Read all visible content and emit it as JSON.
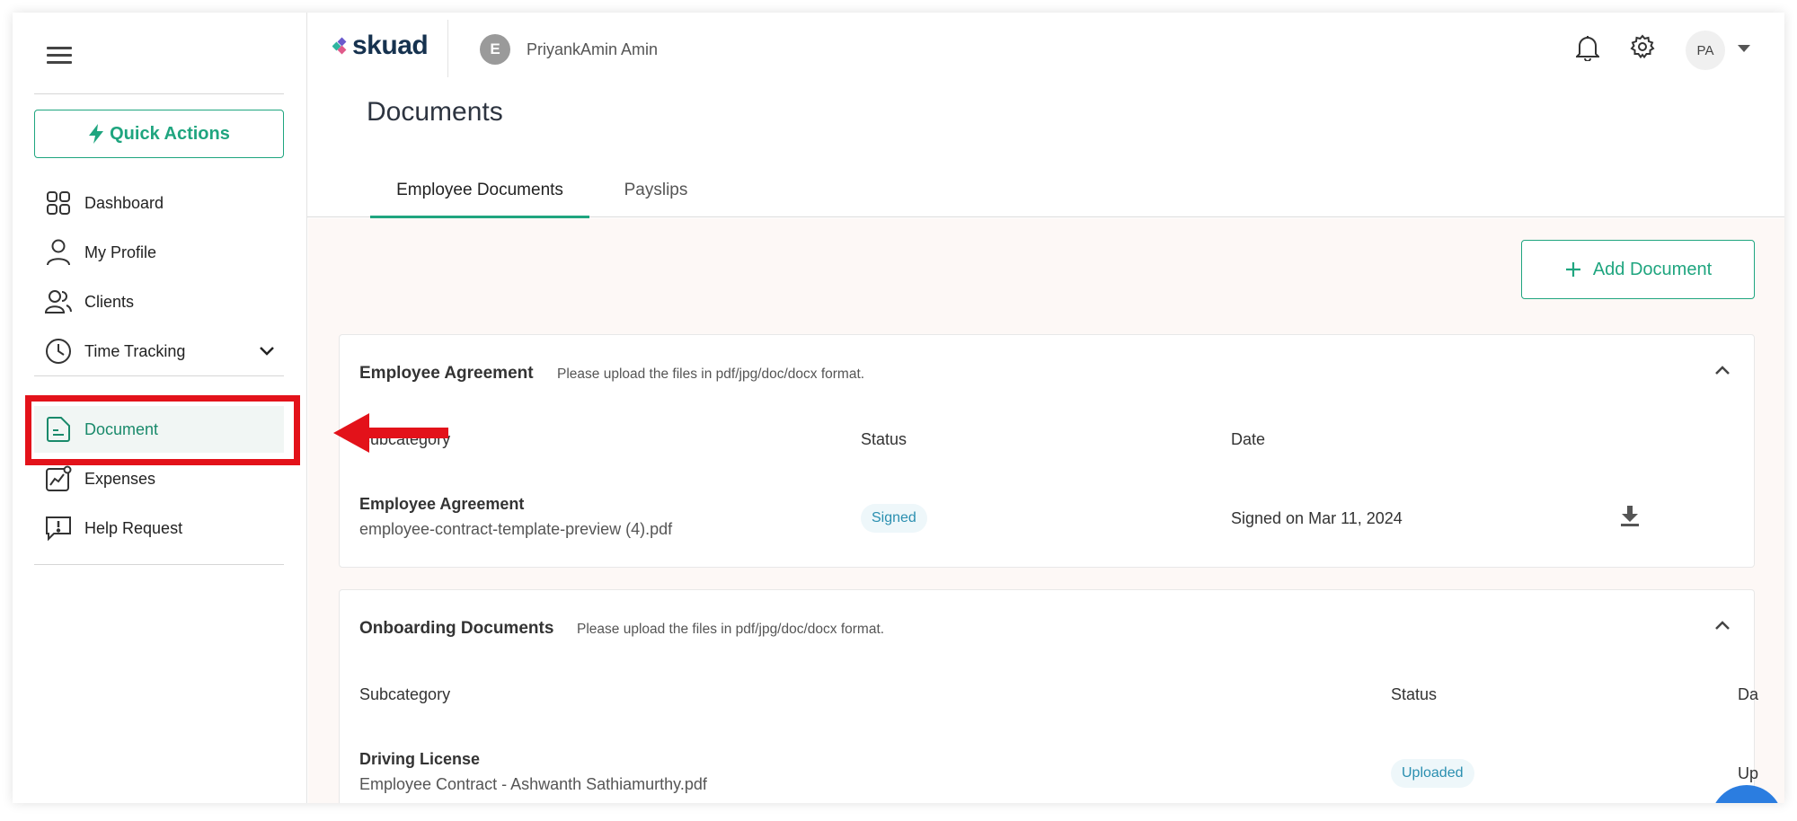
{
  "sidebar": {
    "quick_actions": "Quick Actions",
    "items": [
      {
        "label": "Dashboard",
        "icon": "grid-icon"
      },
      {
        "label": "My Profile",
        "icon": "user-icon"
      },
      {
        "label": "Clients",
        "icon": "clients-icon"
      },
      {
        "label": "Time Tracking",
        "icon": "clock-icon"
      },
      {
        "label": "Document",
        "icon": "document-icon",
        "active": true
      },
      {
        "label": "Expenses",
        "icon": "expenses-icon"
      },
      {
        "label": "Help Request",
        "icon": "help-icon"
      }
    ]
  },
  "header": {
    "logo": "skuad",
    "entity_initial": "E",
    "entity_name": "PriyankAmin Amin",
    "user_initials": "PA"
  },
  "page": {
    "title": "Documents",
    "tabs": [
      "Employee Documents",
      "Payslips"
    ],
    "active_tab": "Employee Documents",
    "add_document": "Add Document"
  },
  "sections": [
    {
      "title": "Employee Agreement",
      "hint": "Please upload the files in pdf/jpg/doc/docx format.",
      "columns": [
        "Subcategory",
        "Status",
        "Date"
      ],
      "rows": [
        {
          "title": "Employee Agreement",
          "file": "employee-contract-template-preview (4).pdf",
          "status": "Signed",
          "date": "Signed on Mar 11, 2024"
        }
      ]
    },
    {
      "title": "Onboarding Documents",
      "hint": "Please upload the files in pdf/jpg/doc/docx format.",
      "columns": [
        "Subcategory",
        "Status",
        "Da"
      ],
      "rows": [
        {
          "title": "Driving License",
          "file": "Employee Contract - Ashwanth Sathiamurthy.pdf",
          "status": "Uploaded",
          "date": "Up"
        }
      ]
    }
  ],
  "colors": {
    "accent": "#1fa57f",
    "highlight": "#e3121a",
    "content_bg": "#fdf8f6"
  }
}
